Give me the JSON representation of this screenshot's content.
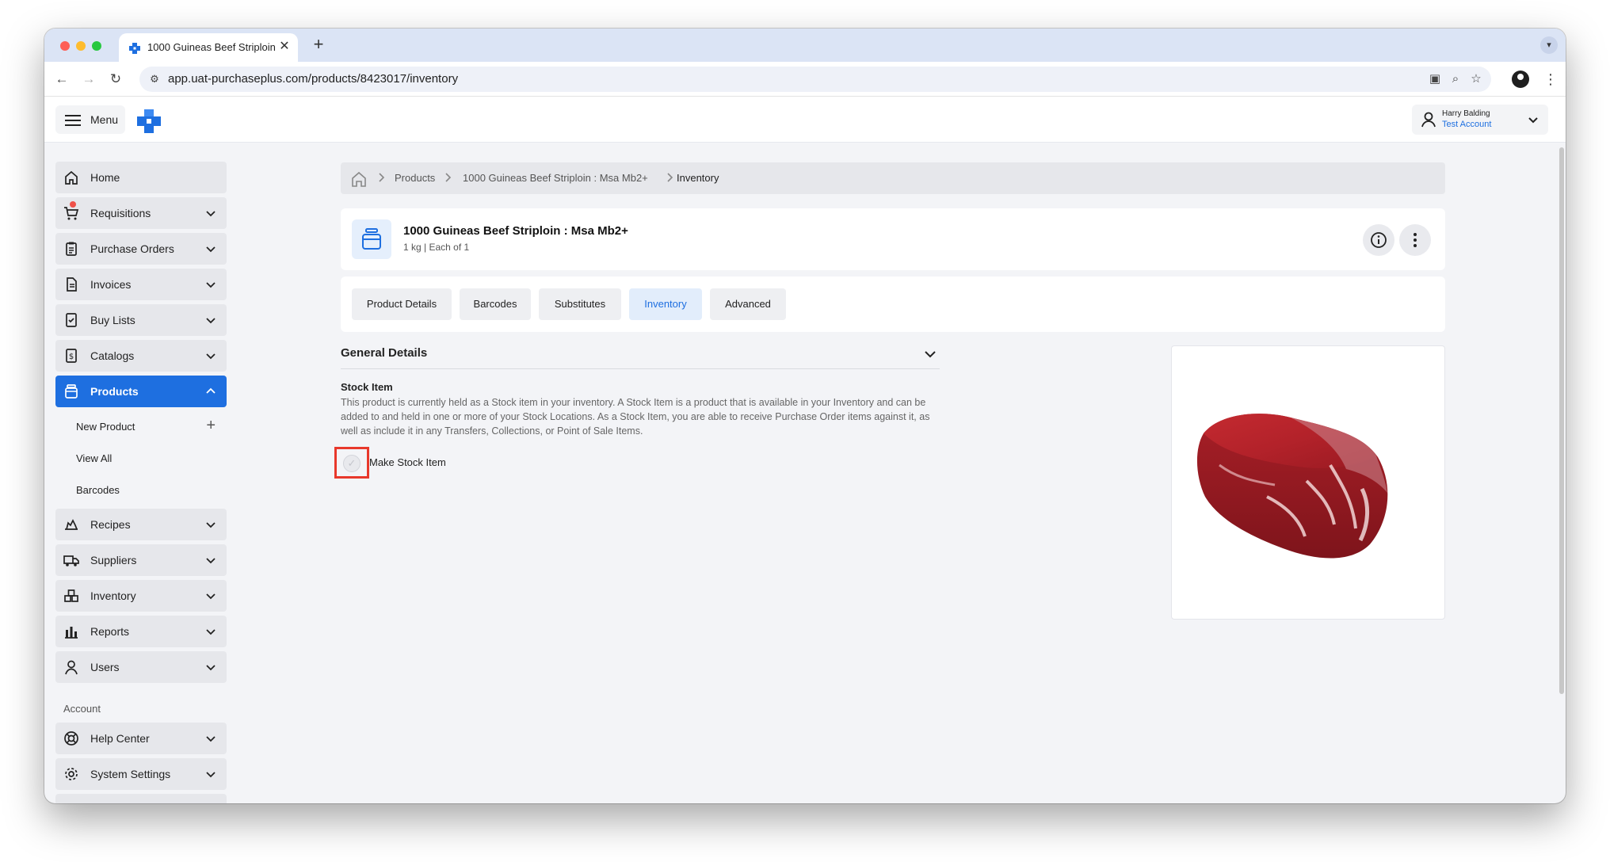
{
  "browser": {
    "tab_title": "1000 Guineas Beef Striploin :",
    "tab_close_glyph": "✕",
    "new_tab_glyph": "+",
    "url": "app.uat-purchaseplus.com/products/8423017/inventory"
  },
  "header": {
    "menu_label": "Menu",
    "user_name": "Harry Balding",
    "user_account": "Test Account"
  },
  "colors": {
    "primary": "#1e6fe0",
    "sidebar_item": "#e6e7eb",
    "highlight": "#e8382b",
    "badge": "#f0524a"
  },
  "sidebar": {
    "items": [
      {
        "label": "Home",
        "icon": "home-icon"
      },
      {
        "label": "Requisitions",
        "icon": "cart-icon"
      },
      {
        "label": "Purchase Orders",
        "icon": "clipboard-icon"
      },
      {
        "label": "Invoices",
        "icon": "document-icon"
      },
      {
        "label": "Buy Lists",
        "icon": "checklist-icon"
      },
      {
        "label": "Catalogs",
        "icon": "dollar-document-icon"
      },
      {
        "label": "Products",
        "icon": "jar-icon",
        "active": true
      },
      {
        "label": "Recipes",
        "icon": "chef-hat-icon"
      },
      {
        "label": "Suppliers",
        "icon": "truck-icon"
      },
      {
        "label": "Inventory",
        "icon": "boxes-icon"
      },
      {
        "label": "Reports",
        "icon": "bar-chart-icon"
      },
      {
        "label": "Users",
        "icon": "user-icon"
      }
    ],
    "sub_items": [
      {
        "label": "New Product",
        "action": "+"
      },
      {
        "label": "View All"
      },
      {
        "label": "Barcodes"
      }
    ],
    "account_heading": "Account",
    "account_items": [
      {
        "label": "Help Center",
        "icon": "lifebuoy-icon"
      },
      {
        "label": "System Settings",
        "icon": "gear-icon"
      }
    ]
  },
  "breadcrumb": {
    "items": [
      "Products",
      "1000 Guineas Beef Striploin : Msa Mb2+",
      "Inventory"
    ]
  },
  "product": {
    "title": "1000 Guineas Beef Striploin : Msa Mb2+",
    "subtitle": "1 kg | Each of 1"
  },
  "tabs": [
    {
      "label": "Product Details"
    },
    {
      "label": "Barcodes"
    },
    {
      "label": "Substitutes"
    },
    {
      "label": "Inventory",
      "active": true
    },
    {
      "label": "Advanced"
    }
  ],
  "general_details": {
    "heading": "General Details",
    "stock_item_title": "Stock Item",
    "stock_item_description": "This product is currently held as a Stock item in your inventory. A Stock Item is a product that is available in your Inventory and can be added to and held in one or more of your Stock Locations. As a Stock Item, you are able to receive Purchase Order items against it, as well as include it in any Transfers, Collections, or Point of Sale Items.",
    "checkbox_label": "Make Stock Item",
    "checkbox_glyph": "✓",
    "checkbox_checked": false
  },
  "image": {
    "subject": "raw beef striploin"
  }
}
